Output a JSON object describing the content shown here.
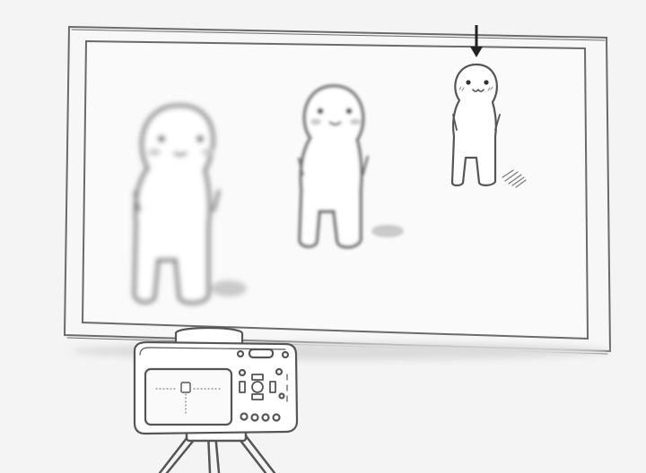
{
  "scene": {
    "background_color": "#f4f4f4",
    "line_color": "#5a5a5a",
    "figure_fill": "#ffffff",
    "arrow_color": "#222222",
    "subjects": [
      {
        "name": "near-figure",
        "focus": "blurred"
      },
      {
        "name": "middle-figure",
        "focus": "slightly-blurred"
      },
      {
        "name": "far-figure",
        "focus": "sharp",
        "marked_by_arrow": true
      }
    ],
    "icons": [
      "camera-icon",
      "tripod-icon",
      "arrow-down-icon"
    ]
  }
}
